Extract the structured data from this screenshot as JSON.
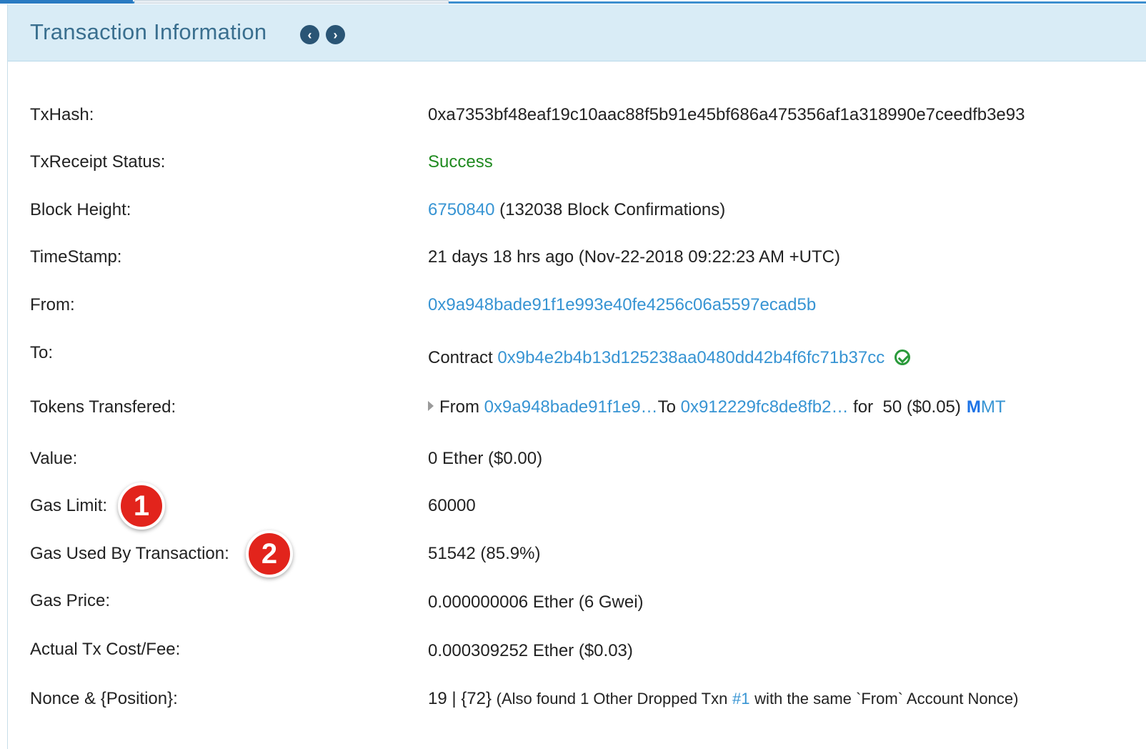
{
  "header": {
    "title": "Transaction Information",
    "prev_icon": "chevron-left-icon",
    "next_icon": "chevron-right-icon"
  },
  "rows": {
    "txhash": {
      "label": "TxHash:",
      "value": "0xa7353bf48eaf19c10aac88f5b91e45bf686a475356af1a318990e7ceedfb3e93"
    },
    "status": {
      "label": "TxReceipt Status:",
      "value": "Success"
    },
    "block": {
      "label": "Block Height:",
      "link": "6750840",
      "extra": "(132038 Block Confirmations)"
    },
    "timestamp": {
      "label": "TimeStamp:",
      "value": "21 days 18 hrs ago (Nov-22-2018 09:22:23 AM +UTC)"
    },
    "from": {
      "label": "From:",
      "value": "0x9a948bade91f1e993e40fe4256c06a5597ecad5b"
    },
    "to": {
      "label": "To:",
      "prefix": "Contract",
      "address": "0x9b4e2b4b13d125238aa0480dd42b4f6fc71b37cc",
      "verified_icon": "check-circle-icon"
    },
    "tokens": {
      "label": "Tokens Transfered:",
      "from_text": "From",
      "from_addr": "0x9a948bade91f1e9…",
      "to_text": "To",
      "to_addr": "0x912229fc8de8fb2…",
      "for_text": "for  50 ($0.05)",
      "token_symbol": "MT",
      "token_logo": "M"
    },
    "value": {
      "label": "Value:",
      "value": "0 Ether ($0.00)"
    },
    "gas_limit": {
      "label": "Gas Limit:",
      "value": "60000"
    },
    "gas_used": {
      "label": "Gas Used By Transaction:",
      "value": "51542 (85.9%)"
    },
    "gas_price": {
      "label": "Gas Price:",
      "value": "0.000000006 Ether (6 Gwei)"
    },
    "fee": {
      "label": "Actual Tx Cost/Fee:",
      "value": "0.000309252 Ether ($0.03)"
    },
    "nonce": {
      "label": "Nonce & {Position}:",
      "value": "19 | {72}",
      "note_pre": "(Also found 1 Other Dropped Txn",
      "note_link": "#1",
      "note_post": "with the same `From` Account Nonce)"
    }
  },
  "annotations": {
    "badge1": "1",
    "badge2": "2"
  },
  "colors": {
    "link": "#3794d3",
    "success": "#1f8a1f",
    "header_bg": "#d9ecf6",
    "badge": "#e2241c"
  }
}
